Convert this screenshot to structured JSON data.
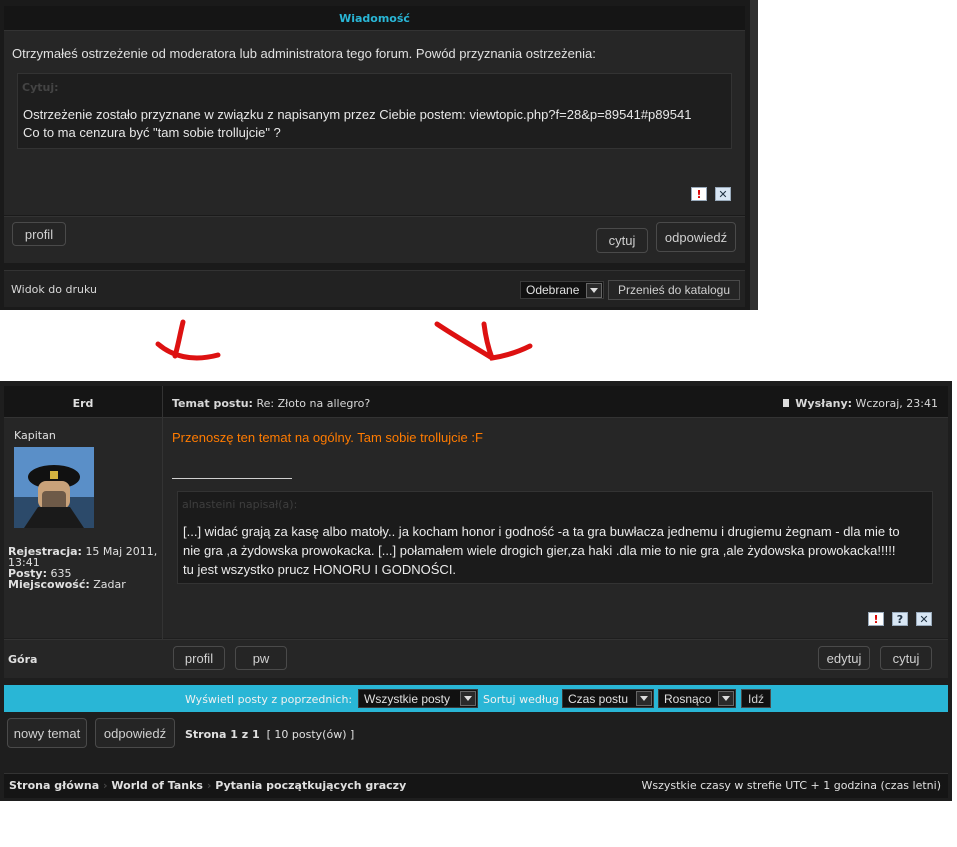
{
  "top_panel": {
    "header": "Wiadomość",
    "intro": "Otrzymałeś ostrzeżenie od moderatora lub administratora tego forum. Powód przyznania ostrzeżenia:",
    "quote_label": "Cytuj:",
    "quote_line1": "Ostrzeżenie zostało przyznane w związku z napisanym przez Ciebie postem: viewtopic.php?f=28&p=89541#p89541",
    "quote_line2": "Co to ma cenzura być \"tam sobie trollujcie\" ?",
    "profile_button": "profil",
    "quote_button": "cytuj",
    "reply_button": "odpowiedź",
    "print_view": "Widok do druku",
    "folder_select": "Odebrane",
    "move_to_folder": "Przenieś do katalogu"
  },
  "post": {
    "author": "Erd",
    "subject_label": "Temat postu:",
    "subject": "Re: Złoto na allegro?",
    "posted_label": "Wysłany:",
    "posted": "Wczoraj, 23:41",
    "rank": "Kapitan",
    "reg_label": "Rejestracja:",
    "reg_value_1": "15 Maj 2011,",
    "reg_value_2": "13:41",
    "posts_label": "Posty:",
    "posts_value": "635",
    "location_label": "Miejscowość:",
    "location_value": "Zadar",
    "mod_message": "Przenoszę ten temat na ogólny. Tam sobie trollujcie :F",
    "quote_author": "alnasteini napisał(a):",
    "quote_line1": "[...] widać grają za kasę albo matoły.. ja kocham honor i godność -a ta gra buwłacza jednemu i drugiemu żegnam - dla mie to",
    "quote_line2": "nie gra ,a żydowska prowokacka. [...] połamałem wiele drogich gier,za haki .dla mie to nie gra ,ale żydowska prowokacka!!!!!",
    "quote_line3": "tu jest wszystko prucz HONORU I GODNOŚCI.",
    "top_link": "Góra",
    "profile_button": "profil",
    "pm_button": "pw",
    "edit_button": "edytuj",
    "quote_button": "cytuj"
  },
  "filter_bar": {
    "show_label": "Wyświetl posty z poprzednich:",
    "show_value": "Wszystkie posty",
    "sort_label": "Sortuj według",
    "sort_value": "Czas postu",
    "order_value": "Rosnąco",
    "go_button": "Idź"
  },
  "pagination": {
    "new_topic_button": "nowy temat",
    "reply_button": "odpowiedź",
    "page_text": "Strona 1 z 1",
    "posts_count": "[ 10 posty(ów) ]"
  },
  "footer": {
    "breadcrumb_1": "Strona główna",
    "breadcrumb_2": "World of Tanks",
    "breadcrumb_3": "Pytania początkujących graczy",
    "timezone": "Wszystkie czasy w strefie UTC + 1 godzina (czas letni)"
  },
  "colors": {
    "accent_cyan": "#29b6d6",
    "moderator_orange": "#ff7b00",
    "arrow_red": "#dd1111",
    "panel_bg": "#262626",
    "header_bg": "#1c1c1c"
  }
}
